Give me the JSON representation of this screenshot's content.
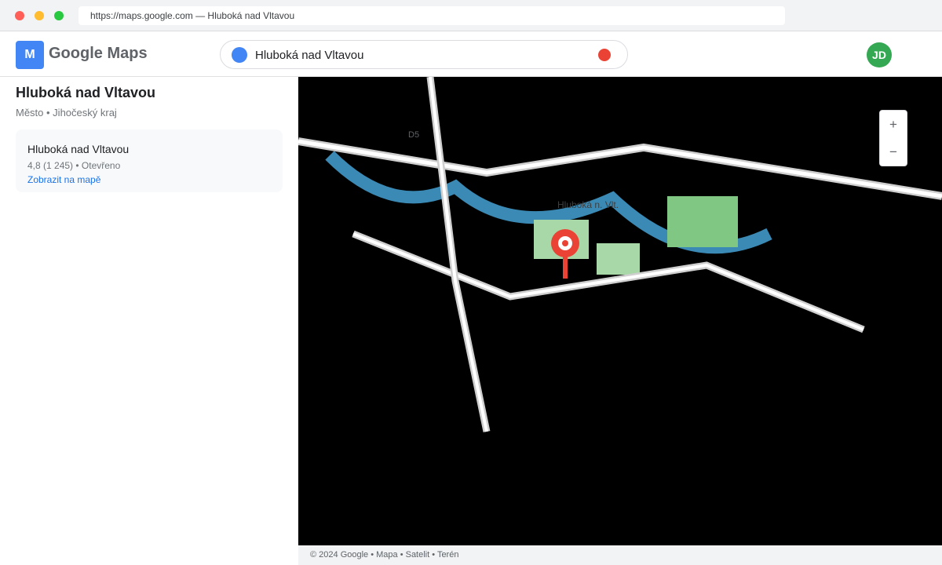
{
  "browser": {
    "url": "https://maps.google.com — Hluboká nad Vltavou"
  },
  "header": {
    "logo_letter": "M",
    "brand": "Google Maps",
    "search_value": "Hluboká nad Vltavou",
    "avatar_initials": "JD"
  },
  "panel": {
    "title": "Hluboká nad Vltavou",
    "subtitle": "Město • Jihočeský kraj",
    "card": {
      "title": "Hluboká nad Vltavou",
      "meta": "4,8 (1 245) • Otevřeno",
      "link": "Zobrazit na mapě"
    }
  },
  "map": {
    "road_label": "D5",
    "place_label": "Hluboká n. Vlt.",
    "zoom_in": "+",
    "zoom_out": "−",
    "colors": {
      "water": "#3a8ab5",
      "park": "#a8d8a8",
      "park_dark": "#81c784",
      "road": "#ffffff",
      "pin": "#ea4335"
    }
  },
  "footer": {
    "text": "© 2024 Google • Mapa • Satelit • Terén"
  }
}
